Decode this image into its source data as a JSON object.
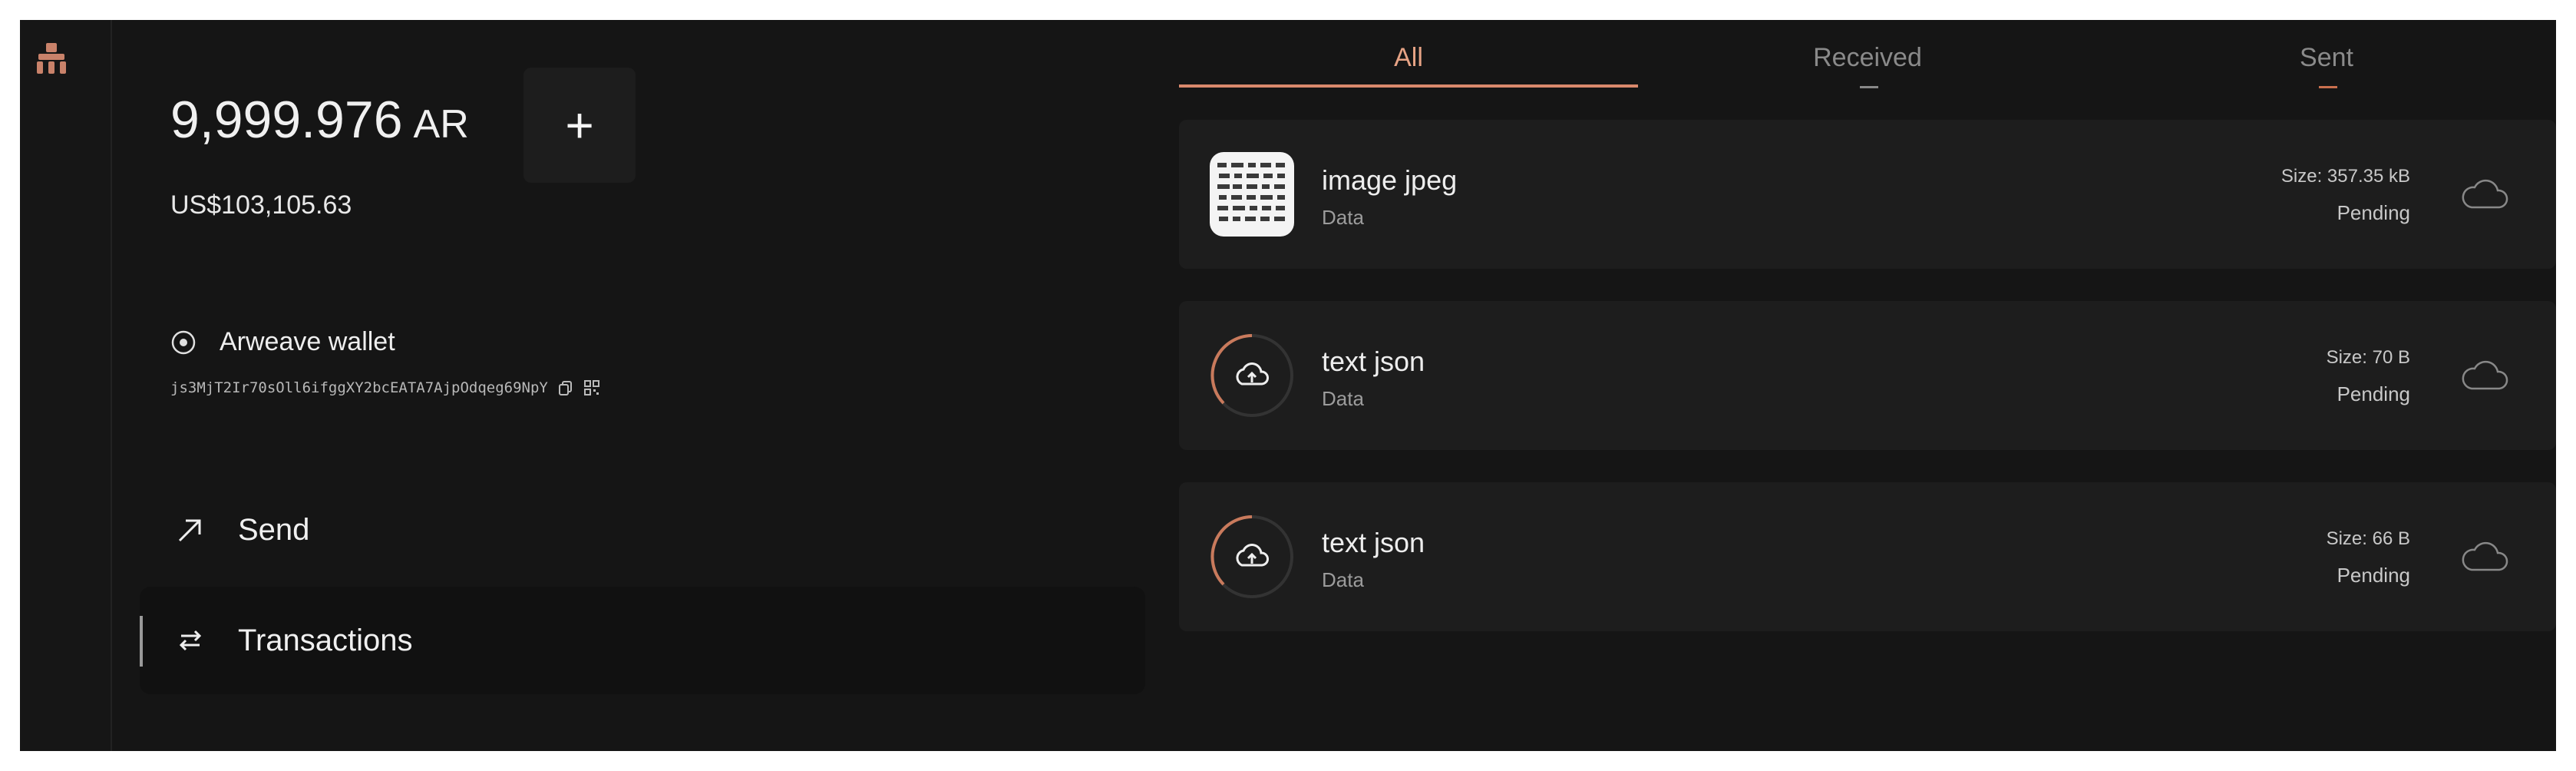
{
  "wallet": {
    "balance_amount": "9,999.976",
    "balance_unit": "AR",
    "add_label": "+",
    "fiat_value": "US$103,105.63",
    "wallet_name": "Arweave wallet",
    "address": "js3MjT2Ir70sOll6ifggXY2bcEATA7AjpOdqeg69NpY"
  },
  "nav": {
    "send_label": "Send",
    "transactions_label": "Transactions"
  },
  "tabs": {
    "all": "All",
    "received": "Received",
    "sent": "Sent"
  },
  "transactions": [
    {
      "title": "image jpeg",
      "subtitle": "Data",
      "size": "Size: 357.35 kB",
      "status": "Pending"
    },
    {
      "title": "text json",
      "subtitle": "Data",
      "size": "Size: 70 B",
      "status": "Pending"
    },
    {
      "title": "text json",
      "subtitle": "Data",
      "size": "Size: 66 B",
      "status": "Pending"
    }
  ],
  "icons": {
    "logo": "arconnect-logo-icon",
    "wallet": "wallet-circle-icon",
    "copy": "copy-icon",
    "qr": "qr-code-icon",
    "send": "arrow-up-right-icon",
    "transactions": "arrows-exchange-icon",
    "upload": "cloud-upload-icon",
    "cloud": "cloud-icon"
  },
  "colors": {
    "background": "#151515",
    "card": "#1d1d1d",
    "accent": "#d9896c",
    "text": "#eeeeee",
    "muted": "#9c9c9c"
  }
}
